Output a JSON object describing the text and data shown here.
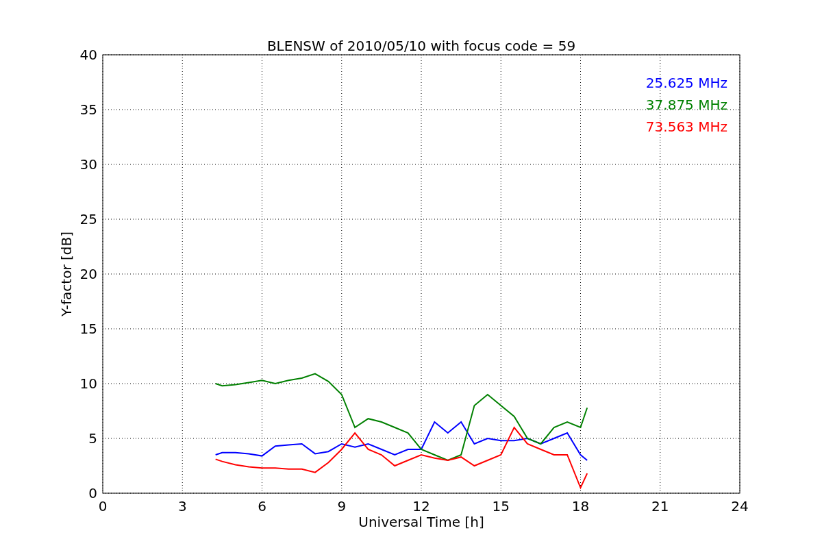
{
  "figure": {
    "chart_data": {
      "type": "line",
      "title": "BLENSW of 2010/05/10 with focus code = 59",
      "xlabel": "Universal Time [h]",
      "ylabel": "Y-factor [dB]",
      "x": [
        4.25,
        4.5,
        5,
        5.5,
        6,
        6.5,
        7,
        7.5,
        8,
        8.5,
        9,
        9.5,
        10,
        10.5,
        11,
        11.5,
        12,
        12.5,
        13,
        13.5,
        14,
        14.5,
        15,
        15.5,
        16,
        16.5,
        17,
        17.5,
        18,
        18.25
      ],
      "series": [
        {
          "name": "25.625 MHz",
          "color": "#0000ff",
          "values": [
            3.5,
            3.7,
            3.7,
            3.6,
            3.4,
            4.3,
            4.4,
            4.5,
            3.6,
            3.8,
            4.5,
            4.2,
            4.5,
            4.0,
            3.5,
            4.0,
            4.0,
            6.5,
            5.5,
            6.5,
            4.5,
            5.0,
            4.8,
            4.8,
            5.0,
            4.5,
            5.0,
            5.5,
            3.5,
            3.0
          ]
        },
        {
          "name": "37.875 MHz",
          "color": "#008000",
          "values": [
            10,
            9.8,
            9.9,
            10.1,
            10.3,
            10.0,
            10.3,
            10.5,
            10.9,
            10.2,
            9.0,
            6.0,
            6.8,
            6.5,
            6.0,
            5.5,
            4.0,
            3.5,
            3.0,
            3.5,
            8.0,
            9.0,
            8.0,
            7.0,
            5.0,
            4.5,
            6.0,
            6.5,
            6.0,
            7.8
          ]
        },
        {
          "name": "73.563 MHz",
          "color": "#ff0000",
          "values": [
            3.1,
            2.9,
            2.6,
            2.4,
            2.3,
            2.3,
            2.2,
            2.2,
            1.9,
            2.8,
            4.0,
            5.5,
            4.0,
            3.5,
            2.5,
            3.0,
            3.5,
            3.2,
            3.0,
            3.3,
            2.5,
            3.0,
            3.5,
            6.0,
            4.5,
            4.0,
            3.5,
            3.5,
            0.5,
            1.8
          ]
        }
      ],
      "grid": true,
      "xlim": [
        0,
        24
      ],
      "ylim": [
        0,
        40
      ],
      "xticks": [
        0,
        3,
        6,
        9,
        12,
        15,
        18,
        21,
        24
      ],
      "yticks": [
        0,
        5,
        10,
        15,
        20,
        25,
        30,
        35,
        40
      ]
    }
  }
}
